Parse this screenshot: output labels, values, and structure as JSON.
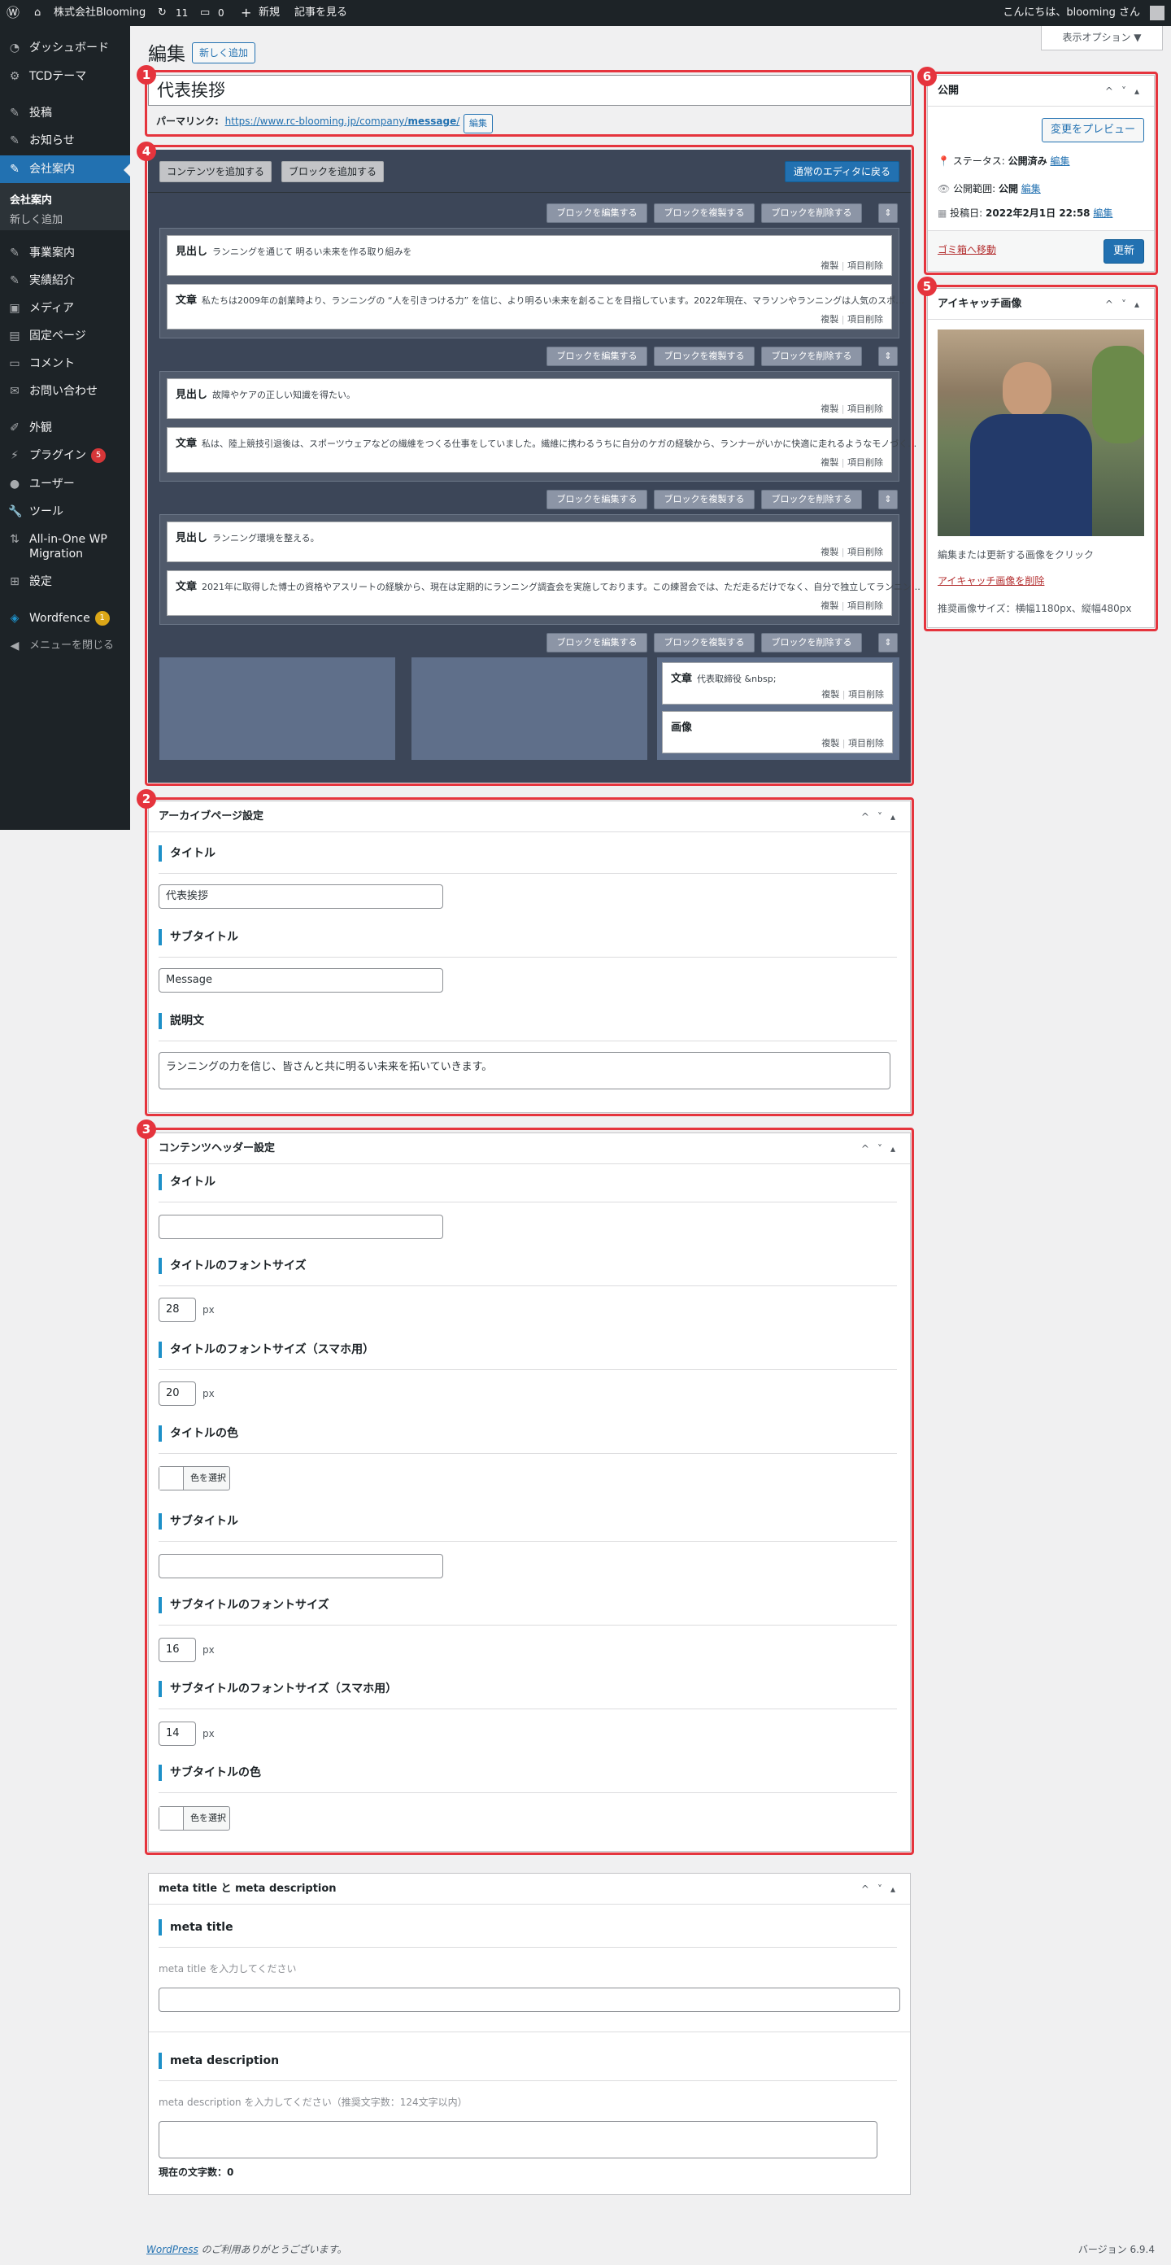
{
  "adminbar": {
    "site_name": "株式会社Blooming",
    "updates": "11",
    "comments": "0",
    "new": "新規",
    "view_post": "記事を見る",
    "greeting": "こんにちは、blooming さん"
  },
  "screen_options": "表示オプション ▼",
  "sidebar": {
    "items": [
      {
        "label": "ダッシュボード",
        "icon": "dashboard-icon"
      },
      {
        "label": "TCDテーマ",
        "icon": "gear-icon"
      },
      {
        "label": "投稿",
        "icon": "pin-icon"
      },
      {
        "label": "お知らせ",
        "icon": "pin-icon"
      },
      {
        "label": "会社案内",
        "icon": "pin-icon"
      },
      {
        "label": "事業案内",
        "icon": "pin-icon"
      },
      {
        "label": "実績紹介",
        "icon": "pin-icon"
      },
      {
        "label": "メディア",
        "icon": "media-icon"
      },
      {
        "label": "固定ページ",
        "icon": "page-icon"
      },
      {
        "label": "コメント",
        "icon": "comment-icon"
      },
      {
        "label": "お問い合わせ",
        "icon": "mail-icon"
      },
      {
        "label": "外観",
        "icon": "brush-icon"
      },
      {
        "label": "プラグイン",
        "icon": "plugin-icon",
        "badge": "5"
      },
      {
        "label": "ユーザー",
        "icon": "user-icon"
      },
      {
        "label": "ツール",
        "icon": "wrench-icon"
      },
      {
        "label": "All-in-One WP",
        "label2": "Migration",
        "icon": "migration-icon"
      },
      {
        "label": "設定",
        "icon": "settings-icon"
      },
      {
        "label": "Wordfence",
        "icon": "wordfence-icon",
        "badge": "1"
      },
      {
        "label": "メニューを閉じる",
        "icon": "collapse-icon"
      }
    ],
    "sub_items": [
      "会社案内",
      "新しく追加"
    ]
  },
  "page": {
    "heading": "編集",
    "add_new": "新しく追加"
  },
  "title_box": {
    "title": "代表挨拶",
    "permalink_label": "パーマリンク:",
    "permalink_prefix": "https://www.rc-blooming.jp/company/",
    "permalink_slug": "message",
    "permalink_suffix": "/",
    "edit": "編集"
  },
  "builder": {
    "add_content": "コンテンツを追加する",
    "add_block": "ブロックを追加する",
    "back_editor": "通常のエディタに戻る",
    "edit_block": "ブロックを編集する",
    "dup_block": "ブロックを複製する",
    "del_block": "ブロックを削除する",
    "dup": "複製",
    "del": "項目削除",
    "blocks": [
      {
        "items": [
          {
            "type": "見出し",
            "text": "ランニングを通じて 明るい未来を作る取り組みを"
          },
          {
            "type": "文章",
            "text": "私たちは2009年の創業時より、ランニングの “人を引きつける力” を信じ、より明るい未来を創ることを目指しています。2022年現在、マラソンやランニングは人気のスポ…"
          }
        ]
      },
      {
        "items": [
          {
            "type": "見出し",
            "text": "故障やケアの正しい知識を得たい。"
          },
          {
            "type": "文章",
            "text": "私は、陸上競技引退後は、スポーツウェアなどの繊維をつくる仕事をしていました。繊維に携わるうちに自分のケガの経験から、ランナーがいかに快適に走れるようなモノづく…"
          }
        ]
      },
      {
        "items": [
          {
            "type": "見出し",
            "text": "ランニング環境を整える。"
          },
          {
            "type": "文章",
            "text": "2021年に取得した博士の資格やアスリートの経験から、現在は定期的にランニング調査会を実施しております。この練習会では、ただ走るだけでなく、自分で独立してランニン…"
          }
        ]
      },
      {
        "items": [
          {
            "type": "文章",
            "text": "代表取締役 &nbsp;"
          },
          {
            "type": "画像",
            "text": ""
          }
        ]
      }
    ]
  },
  "archive": {
    "title": "アーカイブページ設定",
    "fields": {
      "title_label": "タイトル",
      "title_value": "代表挨拶",
      "subtitle_label": "サブタイトル",
      "subtitle_value": "Message",
      "desc_label": "説明文",
      "desc_value": "ランニングの力を信じ、皆さんと共に明るい未来を拓いていきます。"
    }
  },
  "content_header": {
    "title": "コンテンツヘッダー設定",
    "title_label": "タイトル",
    "title_font": "タイトルのフォントサイズ",
    "title_font_val": "28",
    "title_font_sp": "タイトルのフォントサイズ（スマホ用）",
    "title_font_sp_val": "20",
    "title_color": "タイトルの色",
    "subtitle_label": "サブタイトル",
    "sub_font": "サブタイトルのフォントサイズ",
    "sub_font_val": "16",
    "sub_font_sp": "サブタイトルのフォントサイズ（スマホ用）",
    "sub_font_sp_val": "14",
    "sub_color": "サブタイトルの色",
    "px": "px",
    "color_btn": "色を選択"
  },
  "meta": {
    "title": "meta title と meta description",
    "mt_label": "meta title",
    "mt_hint": "meta title を入力してください",
    "md_label": "meta description",
    "md_hint": "meta description を入力してください（推奨文字数：124文字以内）",
    "count": "現在の文字数：0"
  },
  "publish": {
    "title": "公開",
    "preview": "変更をプレビュー",
    "status_label": "ステータス:",
    "status": "公開済み",
    "visibility_label": "公開範囲:",
    "visibility": "公開",
    "date_label": "投稿日:",
    "date": "2022年2月1日 22:58",
    "edit": "編集",
    "trash": "ゴミ箱へ移動",
    "update": "更新"
  },
  "featured": {
    "title": "アイキャッチ画像",
    "hint": "編集または更新する画像をクリック",
    "remove": "アイキャッチ画像を削除",
    "size": "推奨画像サイズ：横幅1180px、縦幅480px"
  },
  "footer": {
    "thanks_link": "WordPress",
    "thanks_rest": " のご利用ありがとうございます。",
    "version": "バージョン 6.9.4"
  },
  "markers": [
    "1",
    "2",
    "3",
    "4",
    "5",
    "6"
  ],
  "colors": {
    "accent": "#2271b1",
    "marker": "#e5343d",
    "admin": "#1d2327",
    "builder": "#3c4658"
  }
}
